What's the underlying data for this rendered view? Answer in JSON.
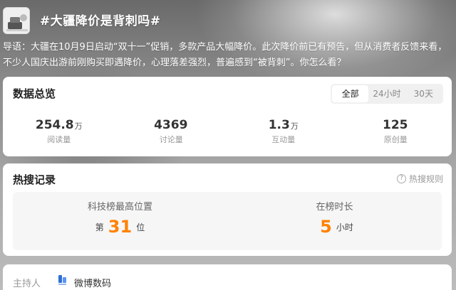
{
  "topic": {
    "title": "#大疆降价是背刺吗#",
    "icon": "topic-thumbnail-icon"
  },
  "intro": "导语：大疆在10月9日启动“双十一”促销，多款产品大幅降价。此次降价前已有预告，但从消费者反馈来看，不少人国庆出游前刚购买即遇降价，心理落差强烈，普遍感到“被背刺”。你怎么看？",
  "overview": {
    "title": "数据总览",
    "tabs": [
      {
        "label": "全部",
        "active": true
      },
      {
        "label": "24小时",
        "active": false
      },
      {
        "label": "30天",
        "active": false
      }
    ],
    "stats": [
      {
        "value": "254.8",
        "unit": "万",
        "label": "阅读量"
      },
      {
        "value": "4369",
        "unit": "",
        "label": "讨论量"
      },
      {
        "value": "1.3",
        "unit": "万",
        "label": "互动量"
      },
      {
        "value": "125",
        "unit": "",
        "label": "原创量"
      }
    ]
  },
  "hot": {
    "title": "热搜记录",
    "rule_label": "热搜规则",
    "rank": {
      "label": "科技榜最高位置",
      "prefix": "第",
      "value": "31",
      "suffix": "位"
    },
    "duration": {
      "label": "在榜时长",
      "value": "5",
      "suffix": "小时"
    }
  },
  "host": {
    "label": "主持人",
    "name": "微博数码",
    "icon": "weibo-digital-logo-icon"
  },
  "colors": {
    "accent": "#ff8200",
    "card": "#ffffff",
    "muted": "#999999"
  }
}
